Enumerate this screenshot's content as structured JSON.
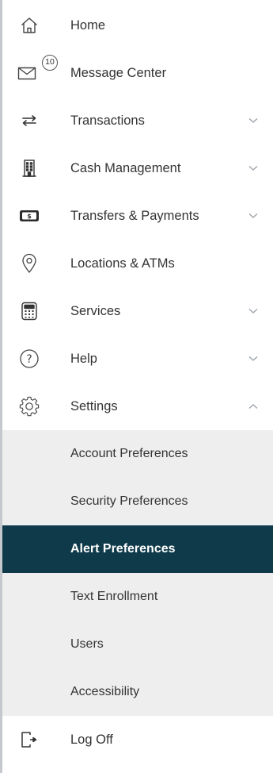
{
  "menu": {
    "home": {
      "label": "Home",
      "icon": "home-icon"
    },
    "messages": {
      "label": "Message Center",
      "icon": "envelope-icon",
      "badge": "10"
    },
    "transactions": {
      "label": "Transactions",
      "icon": "arrows-exchange-icon"
    },
    "cash": {
      "label": "Cash Management",
      "icon": "building-icon"
    },
    "transfers": {
      "label": "Transfers & Payments",
      "icon": "dollar-bill-icon"
    },
    "locations": {
      "label": "Locations & ATMs",
      "icon": "map-pin-icon"
    },
    "services": {
      "label": "Services",
      "icon": "calculator-icon"
    },
    "help": {
      "label": "Help",
      "icon": "question-circle-icon"
    },
    "settings": {
      "label": "Settings",
      "icon": "gear-icon",
      "expanded": true,
      "items": [
        {
          "label": "Account Preferences"
        },
        {
          "label": "Security Preferences"
        },
        {
          "label": "Alert Preferences",
          "active": true
        },
        {
          "label": "Text Enrollment"
        },
        {
          "label": "Users"
        },
        {
          "label": "Accessibility"
        }
      ]
    },
    "logoff": {
      "label": "Log Off",
      "icon": "logout-icon"
    }
  },
  "colors": {
    "active_bg": "#0f3a4a",
    "submenu_bg": "#eeeeee",
    "text": "#333333"
  }
}
